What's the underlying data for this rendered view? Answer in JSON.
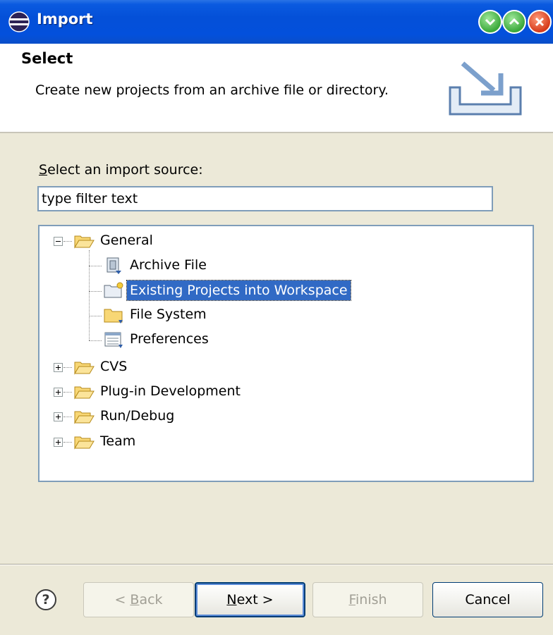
{
  "window": {
    "title": "Import"
  },
  "header": {
    "title": "Select",
    "description": "Create new projects from an archive file or directory."
  },
  "source": {
    "label_accesskey": "S",
    "label_rest": "elect an import source:",
    "filter_value": "type filter text"
  },
  "tree": {
    "general": "General",
    "archive_file": "Archive File",
    "existing_projects": "Existing Projects into Workspace",
    "file_system": "File System",
    "preferences": "Preferences",
    "cvs": "CVS",
    "plugin_development": "Plug-in Development",
    "run_debug": "Run/Debug",
    "team": "Team"
  },
  "buttons": {
    "help": "?",
    "back_prefix": "< ",
    "back_accesskey": "B",
    "back_rest": "ack",
    "next_accesskey": "N",
    "next_rest": "ext >",
    "finish_accesskey": "F",
    "finish_rest": "inish",
    "cancel": "Cancel"
  },
  "colors": {
    "titlebar": "#0450d8",
    "selection": "#316ac5",
    "dialog_bg": "#ece9d8"
  }
}
